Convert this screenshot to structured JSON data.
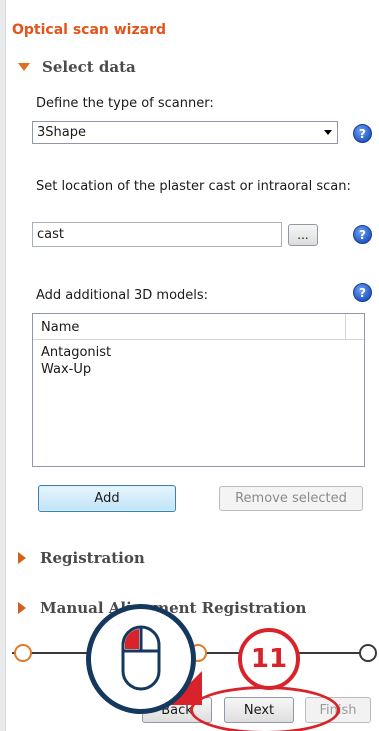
{
  "wizard": {
    "title": "Optical scan wizard"
  },
  "select_data": {
    "header": "Select data",
    "scanner_label": "Define the type of scanner:",
    "scanner_value": "3Shape",
    "location_label": "Set location of the plaster cast or intraoral scan:",
    "location_value": "cast",
    "browse_label": "...",
    "models_label": "Add additional 3D models:",
    "models_column": "Name",
    "models": [
      "Antagonist",
      "Wax-Up"
    ],
    "add_label": "Add",
    "remove_label": "Remove selected"
  },
  "sections": {
    "registration": "Registration",
    "manual_registration": "Manual Alignment Registration"
  },
  "navigation": {
    "back_label": "Back",
    "next_label": "Next",
    "finish_label": "Finish"
  },
  "annotation": {
    "step_number": "11",
    "help_glyph": "?"
  },
  "colors": {
    "accent": "#e5531a",
    "highlight": "#d8232a",
    "callout_border": "#15385f"
  },
  "icons": {
    "expand_open": "triangle-down-icon",
    "expand_closed": "triangle-right-icon",
    "help": "help-icon",
    "mouse": "mouse-icon"
  }
}
